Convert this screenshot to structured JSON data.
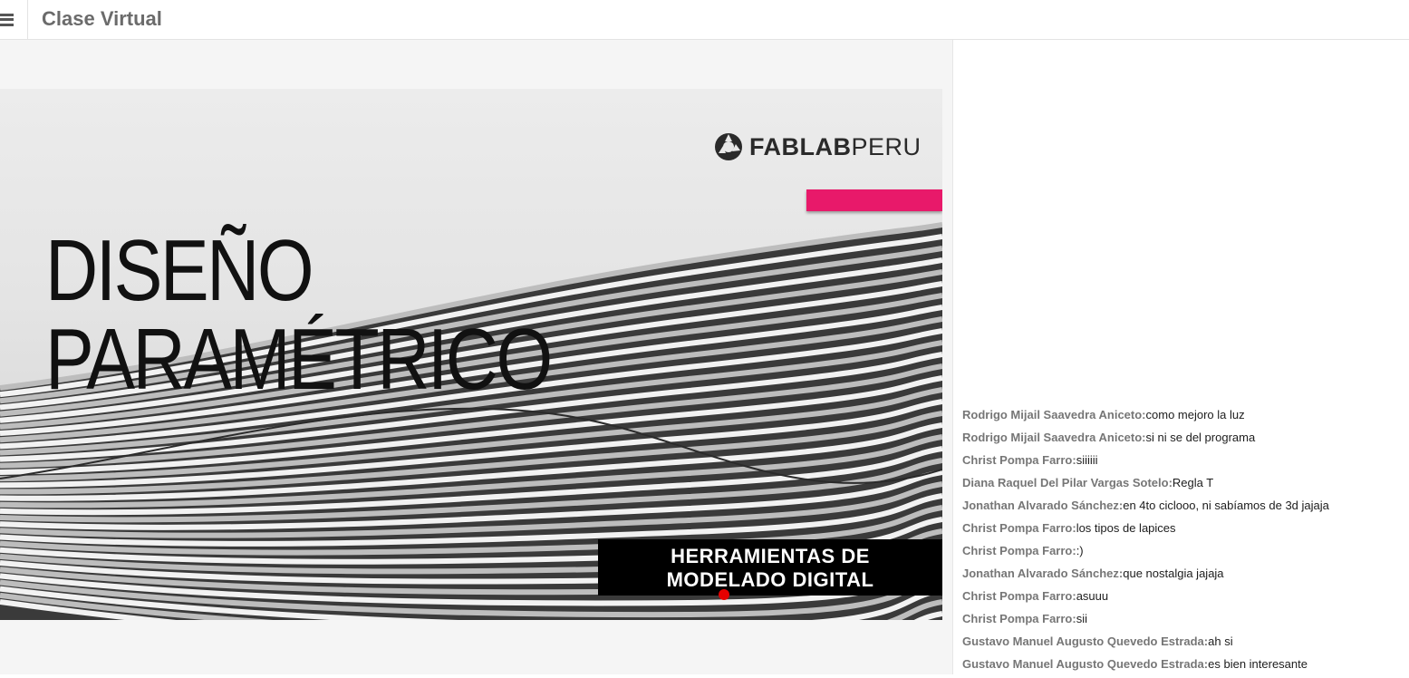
{
  "app": {
    "title": "Clase Virtual",
    "menu_icon": "hamburger-menu-icon"
  },
  "slide": {
    "brand_bold": "FABLAB",
    "brand_light": "PERU",
    "title_line1": "DISEÑO",
    "title_line2": "PARAMÉTRICO",
    "subtitle_line1": "HERRAMIENTAS DE",
    "subtitle_line2": "MODELADO DIGITAL",
    "accent_color": "#e8196a"
  },
  "chat": {
    "messages": [
      {
        "author": "Rodrigo Mijail Saavedra Aniceto:",
        "text": "como mejoro la luz"
      },
      {
        "author": "Rodrigo Mijail Saavedra Aniceto:",
        "text": "si ni se del programa"
      },
      {
        "author": "Christ Pompa Farro:",
        "text": "siiiiii"
      },
      {
        "author": "Diana Raquel Del Pilar Vargas Sotelo:",
        "text": "Regla T"
      },
      {
        "author": "Jonathan Alvarado Sánchez:",
        "text": "en 4to ciclooo, ni sabíamos de 3d jajaja"
      },
      {
        "author": "Christ Pompa Farro:",
        "text": "los tipos de lapices"
      },
      {
        "author": "Christ Pompa Farro:",
        "text": ":)"
      },
      {
        "author": "Jonathan Alvarado Sánchez:",
        "text": "que nostalgia jajaja"
      },
      {
        "author": "Christ Pompa Farro:",
        "text": "asuuu"
      },
      {
        "author": "Christ Pompa Farro:",
        "text": "sii"
      },
      {
        "author": "Gustavo Manuel Augusto Quevedo Estrada:",
        "text": "ah si"
      },
      {
        "author": "Gustavo Manuel Augusto Quevedo Estrada:",
        "text": "es bien interesante"
      }
    ]
  }
}
